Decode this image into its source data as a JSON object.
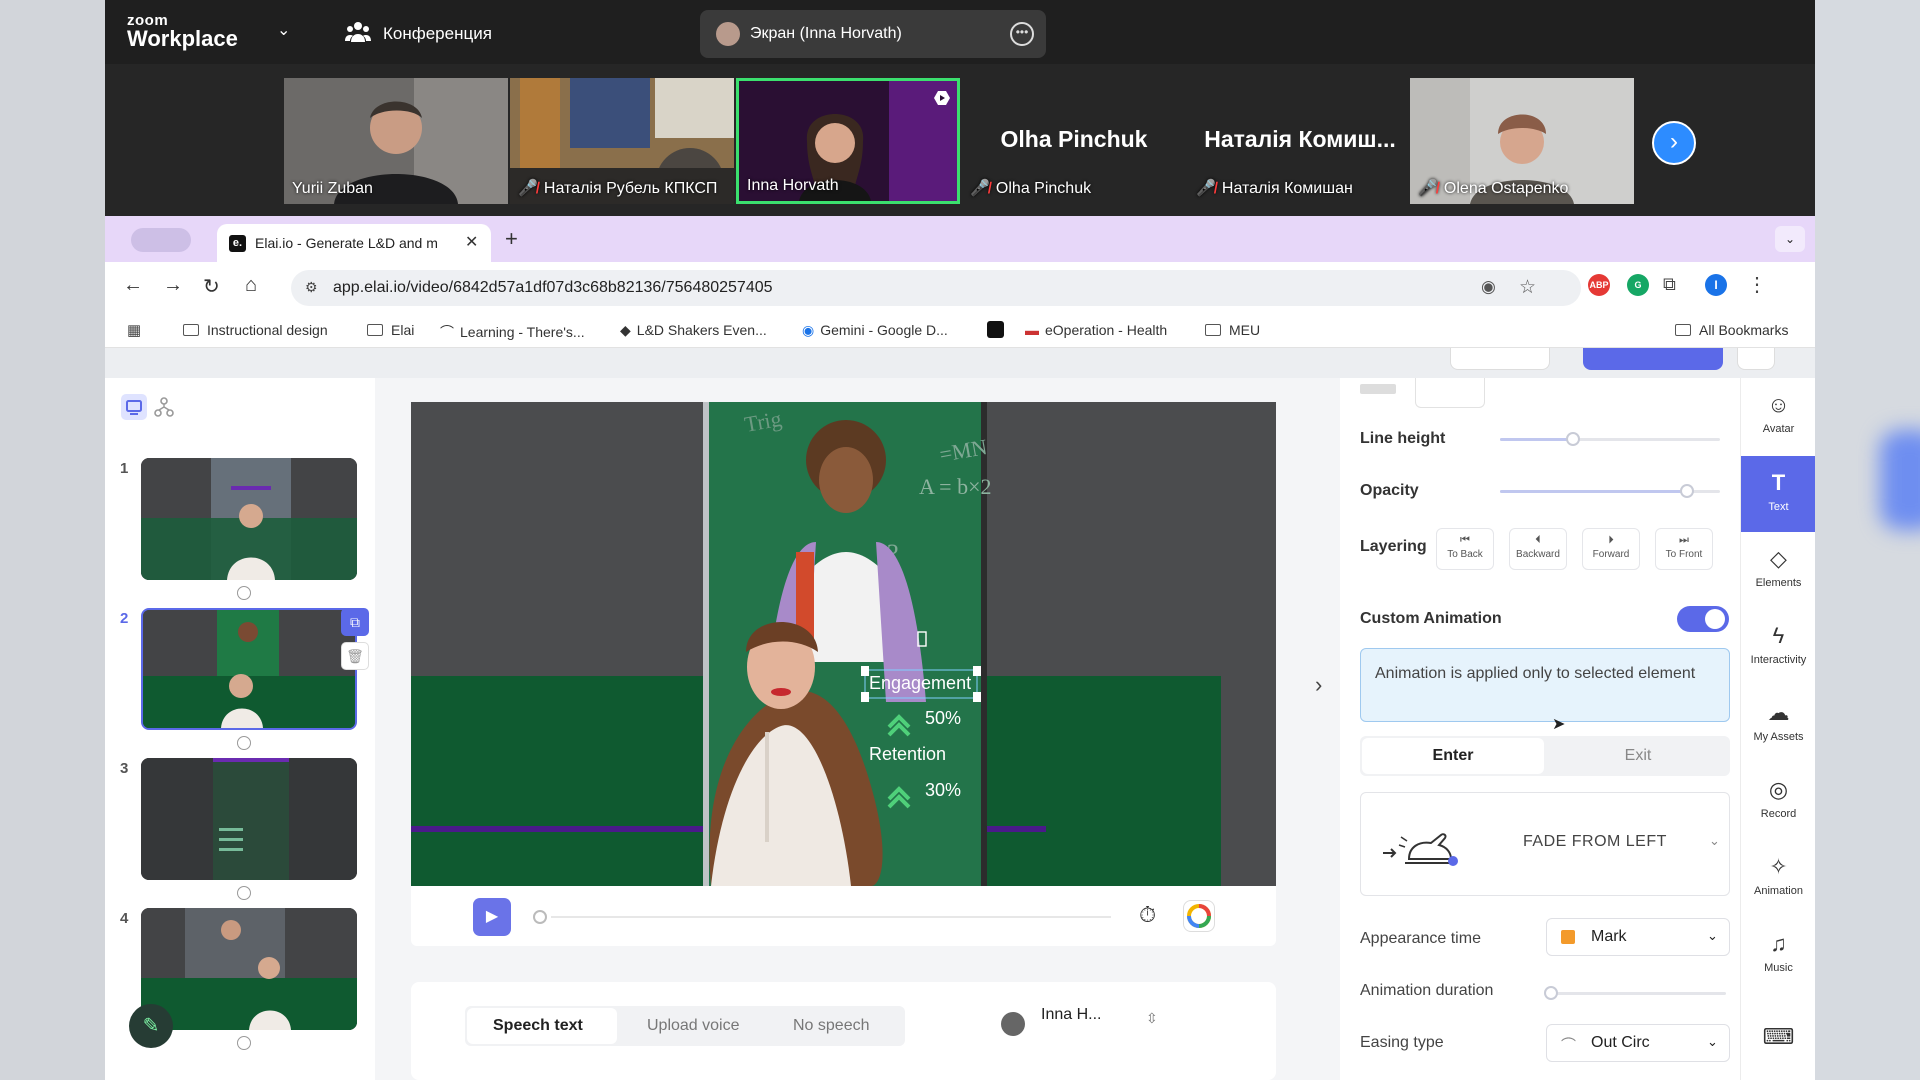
{
  "zoom": {
    "brand_small": "zoom",
    "brand": "Workplace",
    "conference_label": "Конференция",
    "screen_share_label": "Экран (Inna Horvath)",
    "participants": [
      {
        "name": "Yurii Zuban",
        "muted": false,
        "video": true
      },
      {
        "name": "Наталія Рубель КПКСП",
        "muted": true,
        "video": true
      },
      {
        "name": "Inna Horvath",
        "muted": false,
        "video": true,
        "active": true
      },
      {
        "name": "Olha Pinchuk",
        "muted": true,
        "video": false,
        "big_label": "Olha Pinchuk"
      },
      {
        "name": "Наталія Комишан",
        "muted": true,
        "video": false,
        "big_label": "Наталія Комиш..."
      },
      {
        "name": "Olena Ostapenko",
        "muted": true,
        "video": true
      }
    ]
  },
  "browser": {
    "tab_title": "Elai.io - Generate L&D and m",
    "url": "app.elai.io/video/6842d57a1df07d3c68b82136/756480257405",
    "profile_initial": "I",
    "ext_abp": "ABP",
    "bookmarks": [
      "Instructional design",
      "Elai",
      "Learning - There's...",
      "L&D Shakers Even...",
      "Gemini - Google D...",
      "",
      "eOperation - Health",
      "MEU"
    ],
    "all_bookmarks": "All Bookmarks"
  },
  "slides": [
    {
      "number": "1"
    },
    {
      "number": "2"
    },
    {
      "number": "3"
    },
    {
      "number": "4"
    }
  ],
  "canvas": {
    "engagement_label": "Engagement",
    "engagement_value": "50%",
    "retention_label": "Retention",
    "retention_value": "30%",
    "board_text": "A = b×2"
  },
  "speech": {
    "tabs": [
      "Speech text",
      "Upload voice",
      "No speech"
    ],
    "voice": "Inna H..."
  },
  "properties": {
    "line_height_label": "Line height",
    "line_height_value": 0.33,
    "opacity_label": "Opacity",
    "opacity_value": 0.85,
    "layering_label": "Layering",
    "layering_buttons": [
      "To Back",
      "Backward",
      "Forward",
      "To Front"
    ],
    "custom_animation_label": "Custom Animation",
    "custom_animation_on": true,
    "info_text": "Animation is applied only to selected element",
    "tab_enter": "Enter",
    "tab_exit": "Exit",
    "animation_name": "FADE FROM LEFT",
    "appearance_time_label": "Appearance time",
    "appearance_time_value": "Mark",
    "animation_duration_label": "Animation duration",
    "easing_type_label": "Easing type",
    "easing_type_value": "Out Circ"
  },
  "sidebar": [
    {
      "label": "Avatar",
      "icon": "person-icon"
    },
    {
      "label": "Text",
      "icon": "text-icon",
      "active": true
    },
    {
      "label": "Elements",
      "icon": "shapes-icon"
    },
    {
      "label": "Interactivity",
      "icon": "bolt-icon"
    },
    {
      "label": "My Assets",
      "icon": "assets-icon"
    },
    {
      "label": "Record",
      "icon": "record-icon"
    },
    {
      "label": "Animation",
      "icon": "sparkle-icon"
    },
    {
      "label": "Music",
      "icon": "music-icon"
    }
  ],
  "colors": {
    "accent": "#5b69e8",
    "zoom_blue": "#2d8cff",
    "active_speaker": "#3be06e",
    "slide_green": "#0f5a30"
  }
}
